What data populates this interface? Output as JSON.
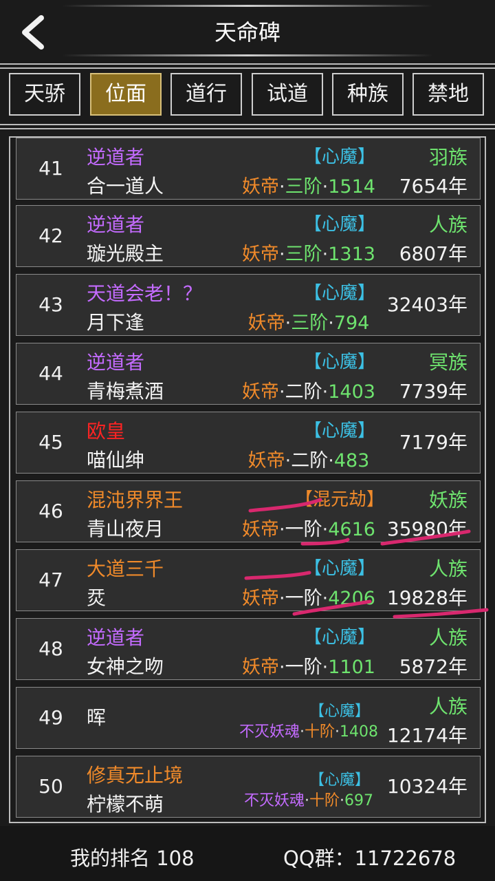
{
  "header": {
    "title": "天命碑",
    "back_icon": "chevron-left-icon"
  },
  "tabs": [
    {
      "label": "天骄",
      "active": false
    },
    {
      "label": "位面",
      "active": true
    },
    {
      "label": "道行",
      "active": false
    },
    {
      "label": "试道",
      "active": false
    },
    {
      "label": "种族",
      "active": false
    },
    {
      "label": "禁地",
      "active": false
    }
  ],
  "rows": [
    {
      "rank": "41",
      "title": "逆道者",
      "name": "合一道人",
      "faction": "【心魔】",
      "realm": [
        "妖帝",
        "·",
        "三阶",
        "·",
        "1514"
      ],
      "race": "羽族",
      "years": "7654年"
    },
    {
      "rank": "42",
      "title": "逆道者",
      "name": "璇光殿主",
      "faction": "【心魔】",
      "realm": [
        "妖帝",
        "·",
        "三阶",
        "·",
        "1313"
      ],
      "race": "人族",
      "years": "6807年"
    },
    {
      "rank": "43",
      "title": "天道会老！？",
      "name": "月下逢",
      "faction": "【心魔】",
      "realm": [
        "妖帝",
        "·",
        "三阶",
        "·",
        "794"
      ],
      "race": "",
      "years": "32403年"
    },
    {
      "rank": "44",
      "title": "逆道者",
      "name": "青梅煮酒",
      "faction": "【心魔】",
      "realm": [
        "妖帝",
        "·",
        "二阶",
        "·",
        "1403"
      ],
      "race": "冥族",
      "years": "7739年"
    },
    {
      "rank": "45",
      "title": "欧皇",
      "name": "喵仙绅",
      "faction": "【心魔】",
      "realm": [
        "妖帝",
        "·",
        "二阶",
        "·",
        "483"
      ],
      "race": "",
      "years": "7179年"
    },
    {
      "rank": "46",
      "title": "混沌界界王",
      "name": "青山夜月",
      "faction": "【混元劫】",
      "realm": [
        "妖帝",
        "·",
        "一阶",
        "·",
        "4616"
      ],
      "race": "妖族",
      "years": "35980年"
    },
    {
      "rank": "47",
      "title": "大道三千",
      "name": "烎",
      "faction": "【心魔】",
      "realm": [
        "妖帝",
        "·",
        "一阶",
        "·",
        "4206"
      ],
      "race": "人族",
      "years": "19828年"
    },
    {
      "rank": "48",
      "title": "逆道者",
      "name": "女神之吻",
      "faction": "【心魔】",
      "realm": [
        "妖帝",
        "·",
        "一阶",
        "·",
        "1101"
      ],
      "race": "人族",
      "years": "5872年"
    },
    {
      "rank": "49",
      "title": "",
      "name": "晖",
      "faction": "【心魔】",
      "realm": [
        "不灭妖魂",
        "·",
        "十阶",
        "·",
        "1408"
      ],
      "race": "人族",
      "years": "12174年"
    },
    {
      "rank": "50",
      "title": "修真无止境",
      "name": "柠檬不萌",
      "faction": "【心魔】",
      "realm": [
        "不灭妖魂",
        "·",
        "十阶",
        "·",
        "697"
      ],
      "race": "",
      "years": "10324年"
    }
  ],
  "footer": {
    "my_rank": "我的排名 108",
    "qq_group": "QQ群：11722678"
  },
  "colors": {
    "purple": "#c46bff",
    "red": "#ff2323",
    "orange": "#f08a2a",
    "green": "#6ee36e",
    "cyan": "#3cc0e4",
    "tab_active": "#8a6d1e",
    "annotation": "#d8286e"
  }
}
